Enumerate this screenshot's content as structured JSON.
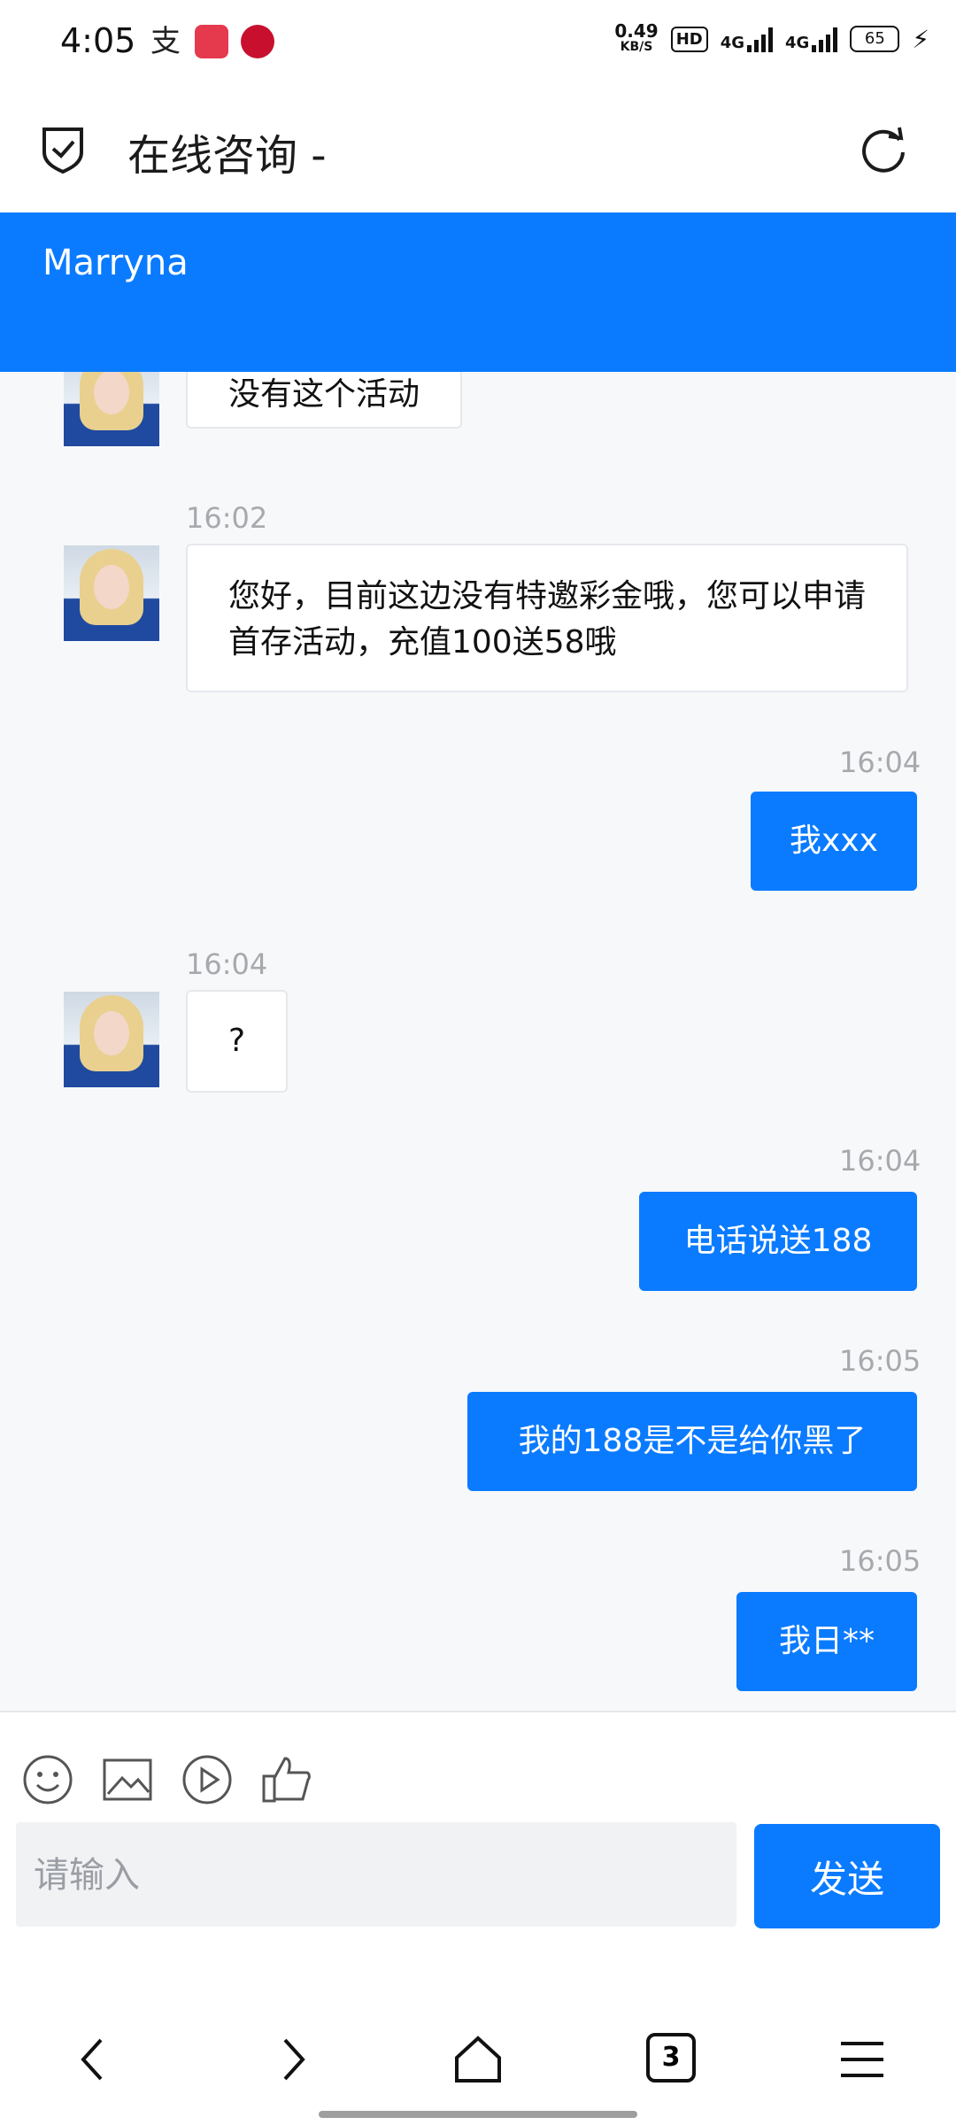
{
  "status": {
    "time": "4:05",
    "speed_value": "0.49",
    "speed_unit": "KB/S",
    "hd": "HD",
    "net1": "4G",
    "net2": "4G",
    "battery": "65"
  },
  "header": {
    "title": "在线咨询 -"
  },
  "agent": {
    "name": "Marryna"
  },
  "messages": [
    {
      "side": "left",
      "time": "",
      "text": "没有这个活动"
    },
    {
      "side": "left",
      "time": "16:02",
      "text": "您好，目前这边没有特邀彩金哦，您可以申请首存活动，充值100送58哦"
    },
    {
      "side": "right",
      "time": "16:04",
      "text": "我xxx"
    },
    {
      "side": "left",
      "time": "16:04",
      "text": "?"
    },
    {
      "side": "right",
      "time": "16:04",
      "text": "电话说送188"
    },
    {
      "side": "right",
      "time": "16:05",
      "text": "我的188是不是给你黑了"
    },
    {
      "side": "right",
      "time": "16:05",
      "text": "我日**"
    }
  ],
  "composer": {
    "placeholder": "请输入",
    "send_label": "发送"
  },
  "browser_nav": {
    "tab_count": "3"
  }
}
